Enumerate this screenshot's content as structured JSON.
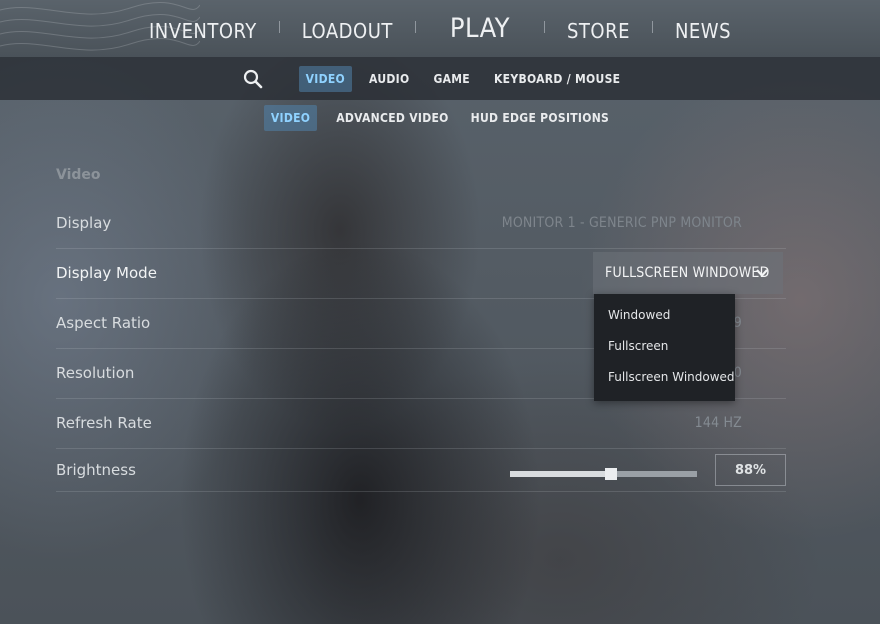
{
  "main_nav": {
    "inventory": "INVENTORY",
    "loadout": "LOADOUT",
    "play": "PLAY",
    "store": "STORE",
    "news": "NEWS"
  },
  "sub_nav": {
    "search_icon": "search-icon",
    "tabs": [
      "VIDEO",
      "AUDIO",
      "GAME",
      "KEYBOARD / MOUSE"
    ],
    "active_tab": "VIDEO"
  },
  "video_tabs": {
    "tabs": [
      "VIDEO",
      "ADVANCED VIDEO",
      "HUD EDGE POSITIONS"
    ],
    "active_tab": "VIDEO"
  },
  "settings": {
    "section_title": "Video",
    "display": {
      "label": "Display",
      "value": "MONITOR 1 - GENERIC PNP MONITOR"
    },
    "display_mode": {
      "label": "Display Mode",
      "value": "FULLSCREEN WINDOWED",
      "options": [
        "Windowed",
        "Fullscreen",
        "Fullscreen Windowed"
      ]
    },
    "aspect_ratio": {
      "label": "Aspect Ratio",
      "value_partial": "9"
    },
    "resolution": {
      "label": "Resolution",
      "value_partial": "0"
    },
    "refresh_rate": {
      "label": "Refresh Rate",
      "value": "144 HZ"
    },
    "brightness": {
      "label": "Brightness",
      "value": "88%",
      "level": 0.54
    }
  },
  "colors": {
    "accent_active": "#8fd2ff",
    "menu_bg": "#1f2226"
  }
}
